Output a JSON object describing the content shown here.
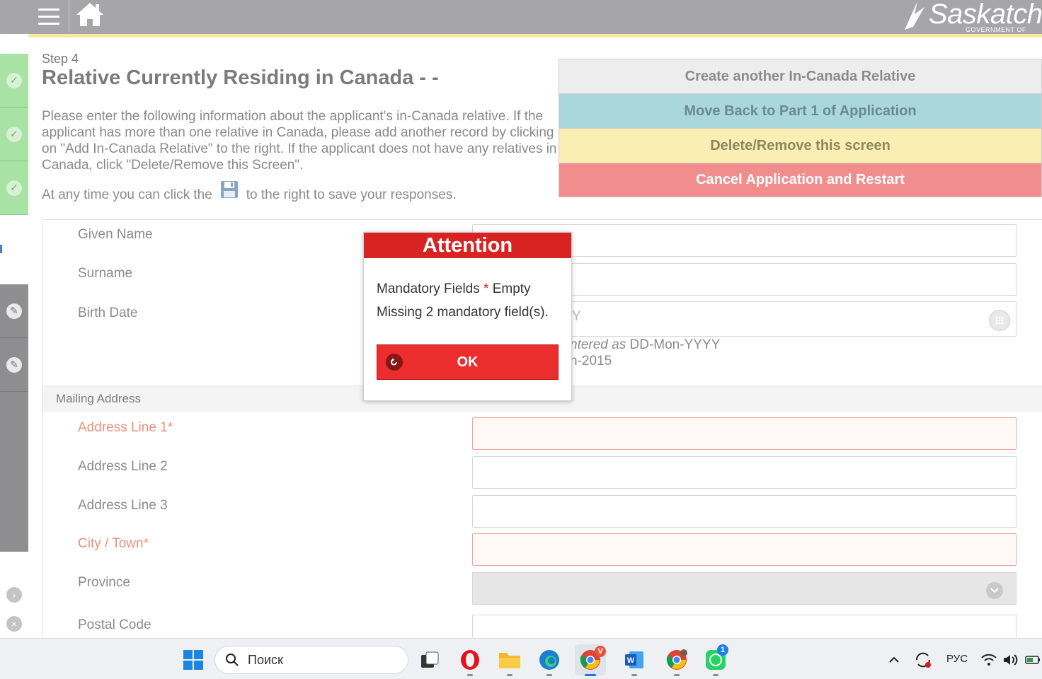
{
  "header": {
    "brand_name": "Saskatch",
    "brand_sub": "GOVERNMENT OF",
    "menu_icon": "hamburger-menu-icon",
    "home_icon": "home-icon"
  },
  "page": {
    "step": "Step 4",
    "title": "Relative Currently Residing in Canada - -",
    "instructions": "Please enter the following information about the applicant's in-Canada relative. If the applicant has more than one relative in Canada, please add another record by clicking on \"Add In-Canada Relative\" to the right. If the applicant does not have any relatives in Canada, click \"Delete/Remove this Screen\".",
    "save_before": "At any time you can click the",
    "save_after": "to the right to save your responses."
  },
  "actions": {
    "create": "Create another In-Canada Relative",
    "back": "Move Back to Part 1 of Application",
    "delete": "Delete/Remove this screen",
    "cancel": "Cancel Application and Restart"
  },
  "form": {
    "given_name": "Given Name",
    "surname": "Surname",
    "birth_date": "Birth Date",
    "birth_date_placeholder_visible": "Y",
    "hint_line1_italic": "ntered as",
    "hint_line1_format": "DD-Mon-YYYY",
    "hint_line2": "n-2015",
    "section_mailing": "Mailing Address",
    "address1": "Address Line 1*",
    "address2": "Address Line 2",
    "address3": "Address Line 3",
    "city": "City / Town*",
    "province": "Province",
    "postal": "Postal Code"
  },
  "modal": {
    "title": "Attention",
    "line1_a": "Mandatory Fields",
    "line1_star": "*",
    "line1_b": "Empty",
    "line2": "Missing 2 mandatory field(s).",
    "ok": "OK"
  },
  "taskbar": {
    "search_placeholder": "Поиск",
    "lang": "РУС",
    "chrome_badge": "V",
    "whatsapp_badge": "1"
  },
  "colors": {
    "header_gray": "#a6a6a8",
    "accent_yellow": "#f6ea9c",
    "success_green": "#a8e2a4",
    "alert_red": "#d92323",
    "required_label": "#e9917a"
  }
}
